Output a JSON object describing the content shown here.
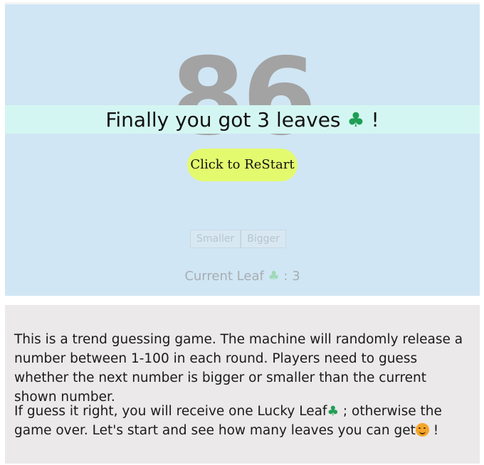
{
  "game": {
    "current_number": "86",
    "result": {
      "prefix": "Finally you got 3 leaves",
      "suffix": "!"
    },
    "restart_label": "Click to ReStart",
    "smaller_label": "Smaller",
    "bigger_label": "Bigger",
    "current_leaf": {
      "label": "Current Leaf",
      "separator": ": 3"
    }
  },
  "icons": {
    "leaf": "♣",
    "leaf_name": "four-leaf-clover-icon",
    "smile_name": "smiling-face-icon"
  },
  "colors": {
    "game_panel_bg": "#d0e6f4",
    "banner_bg": "#d4f6f2",
    "restart_button_bg": "#e3fa6e",
    "info_panel_bg": "#ebe9e9",
    "number_color": "#a3a3a3",
    "leaf_color": "#1f9e55"
  },
  "info": {
    "paragraph_1": "This is a trend guessing game. The machine will randomly release a number between 1-100 in each round. Players need to guess whether the next number is bigger or smaller than the current shown number.",
    "paragraph_2_part_1": "If guess it right, you will receive one Lucky Leaf",
    "paragraph_2_part_2": "; otherwise the game over. Let's start and see how many leaves you can get",
    "paragraph_2_part_3": "!"
  }
}
